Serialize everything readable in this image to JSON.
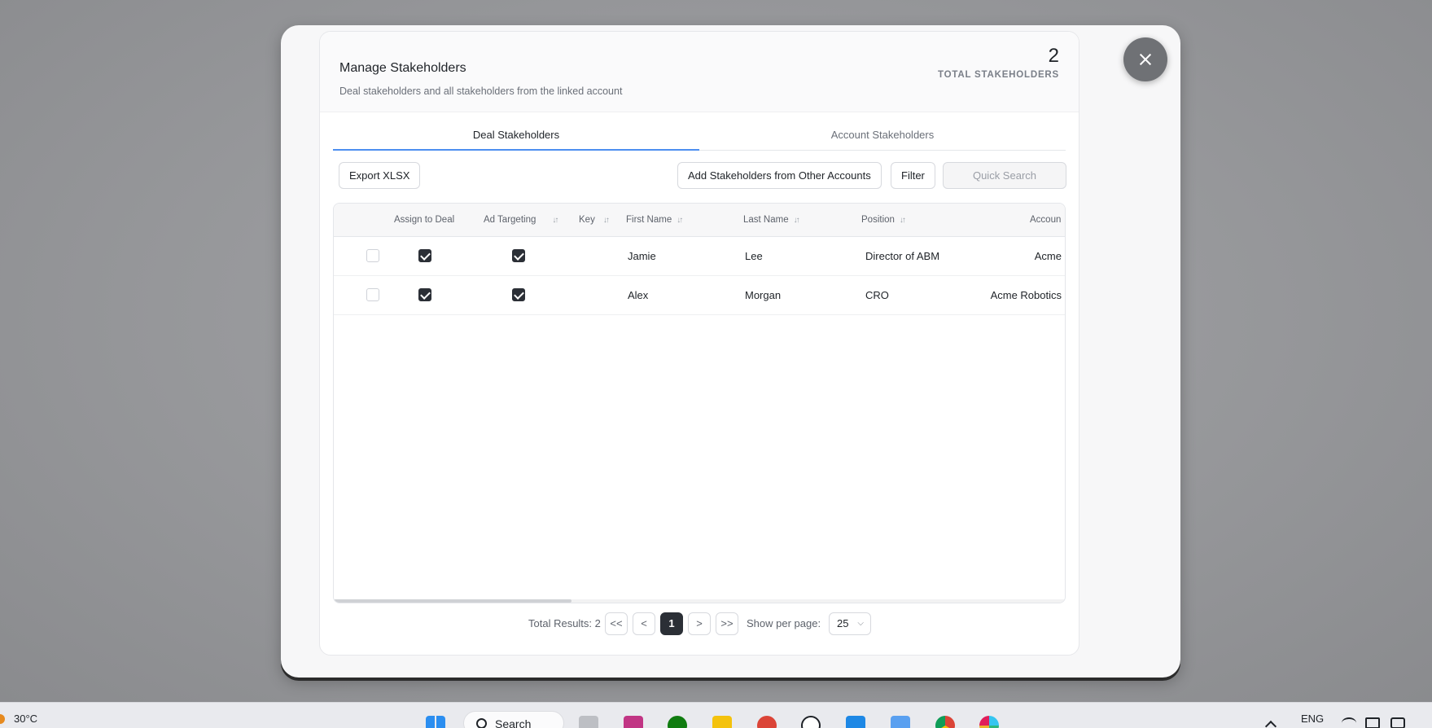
{
  "modal": {
    "title": "Manage Stakeholders",
    "subtitle": "Deal stakeholders and all stakeholders from the linked account",
    "total_count": "2",
    "total_label": "TOTAL STAKEHOLDERS",
    "close_icon": "close-icon"
  },
  "tabs": [
    {
      "label": "Deal Stakeholders",
      "active": true
    },
    {
      "label": "Account Stakeholders",
      "active": false
    }
  ],
  "toolbar": {
    "export_label": "Export XLSX",
    "add_label": "Add Stakeholders from Other Accounts",
    "filter_label": "Filter",
    "search_placeholder": "Quick Search"
  },
  "table": {
    "columns": [
      "Assign to Deal",
      "Ad Targeting",
      "Key",
      "First Name",
      "Last Name",
      "Position",
      "Accoun"
    ],
    "sort_icon": "sort-icon",
    "rows": [
      {
        "selected": false,
        "assign_to_deal": true,
        "ad_targeting": true,
        "first_name": "Jamie",
        "last_name": "Lee",
        "position": "Director of ABM",
        "account": "Acme"
      },
      {
        "selected": false,
        "assign_to_deal": true,
        "ad_targeting": true,
        "first_name": "Alex",
        "last_name": "Morgan",
        "position": "CRO",
        "account": "Acme Robotics"
      }
    ]
  },
  "pagination": {
    "total_results": "Total Results: 2",
    "first": "<<",
    "prev": "<",
    "current_page": "1",
    "next": ">",
    "last": ">>",
    "per_page_label": "Show per page:",
    "per_page_value": "25"
  },
  "taskbar": {
    "temperature": "30°C",
    "search_label": "Search",
    "language": "ENG",
    "colors": {
      "windows": "#2b8ef0",
      "instagram": "#c13584",
      "xbox": "#107c10",
      "notes": "#f4c20d",
      "vscode": "#1e88e5",
      "chrome": "#db4437"
    }
  }
}
